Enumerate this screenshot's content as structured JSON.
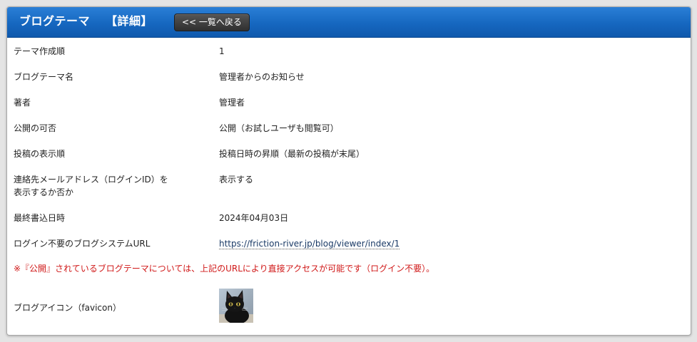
{
  "header": {
    "title": "ブログテーマ",
    "detail": "【詳細】",
    "back_label": "<< 一覧へ戻る"
  },
  "fields": [
    {
      "label": "テーマ作成順",
      "value": "1"
    },
    {
      "label": "ブログテーマ名",
      "value": "管理者からのお知らせ"
    },
    {
      "label": "著者",
      "value": "管理者"
    },
    {
      "label": "公開の可否",
      "value": "公開（お試しユーザも閲覧可）"
    },
    {
      "label": "投稿の表示順",
      "value": "投稿日時の昇順（最新の投稿が末尾）"
    },
    {
      "label_line1": "連絡先メールアドレス（ログインID）を",
      "label_line2": "表示するか否か",
      "value": "表示する"
    },
    {
      "label": "最終書込日時",
      "value": "2024年04月03日"
    },
    {
      "label": "ログイン不要のブログシステムURL",
      "value": "https://friction-river.jp/blog/viewer/index/1"
    }
  ],
  "notice": "※『公開』されているブログテーマについては、上記のURLにより直接アクセスが可能です（ログイン不要）。",
  "favicon": {
    "label": "ブログアイコン（favicon）",
    "image": "black-kitten-image"
  },
  "colors": {
    "header_blue": "#1667c0",
    "notice_red": "#d01818",
    "button_dark": "#3a3a3a"
  }
}
